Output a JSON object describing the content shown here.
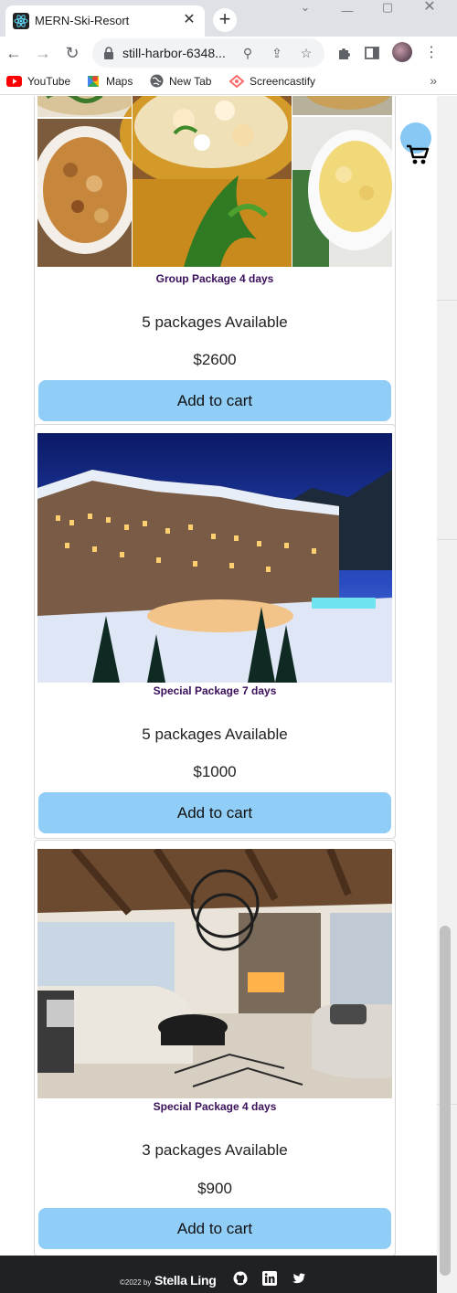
{
  "browser": {
    "tab_title": "MERN-Ski-Resort",
    "tab_close": "✕",
    "new_tab": "+",
    "url": "still-harbor-6348...",
    "bookmarks": [
      {
        "label": "YouTube",
        "icon": "youtube-icon"
      },
      {
        "label": "Maps",
        "icon": "maps-icon"
      },
      {
        "label": "New Tab",
        "icon": "globe-icon"
      },
      {
        "label": "Screencastify",
        "icon": "screencastify-icon"
      }
    ],
    "bookmarks_more": "»"
  },
  "packages": [
    {
      "title": "Group Package 4 days",
      "availability": "5 packages Available",
      "price": "$2600",
      "button": "Add to cart"
    },
    {
      "title": "Special Package 7 days",
      "availability": "5 packages Available",
      "price": "$1000",
      "button": "Add to cart"
    },
    {
      "title": "Special Package 4 days",
      "availability": "3 packages Available",
      "price": "$900",
      "button": "Add to cart"
    }
  ],
  "footer": {
    "copyright": "©2022 by",
    "author": "Stella Ling",
    "links": [
      "github-icon",
      "linkedin-icon",
      "twitter-icon"
    ]
  },
  "colors": {
    "button": "#90cdf7",
    "title": "#3a0f5a",
    "footer_bg": "#1f2124",
    "cart_bubble": "#87c8f5"
  }
}
